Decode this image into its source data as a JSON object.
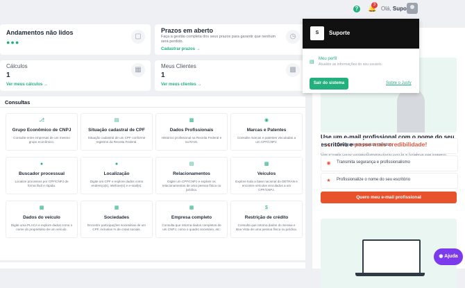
{
  "header": {
    "notification_count": "3",
    "greeting_prefix": "Olá,",
    "user_first_name": "Suporte"
  },
  "cards": {
    "andamentos": {
      "title": "Andamentos não lidos"
    },
    "prazos": {
      "title": "Prazos em aberto",
      "subtitle": "Faça a gestão completa dos seus prazos para garantir que nenhum será perdido.",
      "link": "Cadastrar prazos →"
    },
    "calculos": {
      "label": "Cálculos",
      "value": "1",
      "link": "Ver meus cálculos →"
    },
    "clientes": {
      "label": "Meus Clientes",
      "value": "1",
      "link": "Ver meus clientes →"
    }
  },
  "consultas": {
    "title": "Consultas",
    "tiles": [
      {
        "name": "Grupo Econômico de CNPJ",
        "desc": "Consulte entre empresas de um mesmo grupo econômico."
      },
      {
        "name": "Situação cadastral de CPF",
        "desc": "Situação cadastral de um CPF conforme registros da Receita Federal."
      },
      {
        "name": "Dados Profissionais",
        "desc": "Histórico profissional na Receita Federal e na RAIS."
      },
      {
        "name": "Marcas e Patentes",
        "desc": "Consulte marcas e patentes vinculadas a um CPF/CNPJ."
      },
      {
        "name": "Buscador processual",
        "desc": "Localize processos por CPF/CNPJ de forma fácil e rápida."
      },
      {
        "name": "Localização",
        "desc": "Digite um CPF e explore dados como endereço(s), telefone(s) e e-mail(s)."
      },
      {
        "name": "Relacionamentos",
        "desc": "Digite um CPF/CNPJ e explore os relacionamentos de uma pessoa física ou jurídica."
      },
      {
        "name": "Veículos",
        "desc": "Explore toda a base nacional do DETRAN e encontre veículos vinculados a um CPF/CNPJ."
      },
      {
        "name": "Dados do veículo",
        "desc": "Digite uma PLACA e explore dados como o nome do proprietário de um veículo."
      },
      {
        "name": "Sociedades",
        "desc": "Encontre participações societárias de um CPF, inclusive % de cotas sociais."
      },
      {
        "name": "Empresa completo",
        "desc": "Consulta que retorna dados completos de um CNPJ, como o quadro societário, etc."
      },
      {
        "name": "Restrição de crédito",
        "desc": "Consulta que retorna dados do Serasa e Boa Vista de uma pessoa física ou jurídica."
      }
    ]
  },
  "promo": {
    "title_part1": "Use um e-mail profissional com o nome do seu escritório e ",
    "title_highlight": "passe mais credibilidade!",
    "subtitle": "Use e-mails como contato@seuescritorio.com.br e fortaleça sua imagem.",
    "features": [
      "Configure em poucos minutos",
      "Transmita segurança e profissionalismo",
      "Profissionalize o nome do seu escritório"
    ],
    "cta": "Quero meu e-mail profissional"
  },
  "dropdown": {
    "avatar_letter": "S",
    "name": "Suporte",
    "profile_link": "Meu perfil",
    "profile_desc": "Atualize as informações do seu usuário.",
    "logout": "Sair do sistema",
    "about": "Sobre o Jusfy"
  },
  "help_button": "Ajuda",
  "colors": {
    "accent": "#22b07d",
    "cta": "#e7522d",
    "help": "#7c3aed"
  }
}
